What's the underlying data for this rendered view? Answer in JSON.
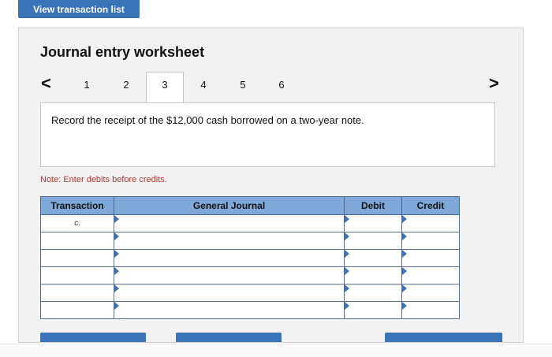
{
  "top_button": {
    "label": "View transaction list"
  },
  "worksheet": {
    "title": "Journal entry worksheet",
    "pager": {
      "prev_symbol": "<",
      "next_symbol": ">",
      "pages": [
        "1",
        "2",
        "3",
        "4",
        "5",
        "6"
      ],
      "active_page": "3"
    },
    "prompt": "Record the receipt of the $12,000 cash borrowed on a two-year note.",
    "note": "Note: Enter debits before credits."
  },
  "journal_table": {
    "headers": {
      "transaction": "Transaction",
      "general_journal": "General Journal",
      "debit": "Debit",
      "credit": "Credit"
    },
    "rows": [
      {
        "transaction": "c.",
        "account": "",
        "debit": "",
        "credit": ""
      },
      {
        "transaction": "",
        "account": "",
        "debit": "",
        "credit": ""
      },
      {
        "transaction": "",
        "account": "",
        "debit": "",
        "credit": ""
      },
      {
        "transaction": "",
        "account": "",
        "debit": "",
        "credit": ""
      },
      {
        "transaction": "",
        "account": "",
        "debit": "",
        "credit": ""
      },
      {
        "transaction": "",
        "account": "",
        "debit": "",
        "credit": ""
      }
    ]
  },
  "colors": {
    "accent": "#3b73b9",
    "table_header": "#7ea8d8",
    "note_text": "#b03a2e"
  }
}
